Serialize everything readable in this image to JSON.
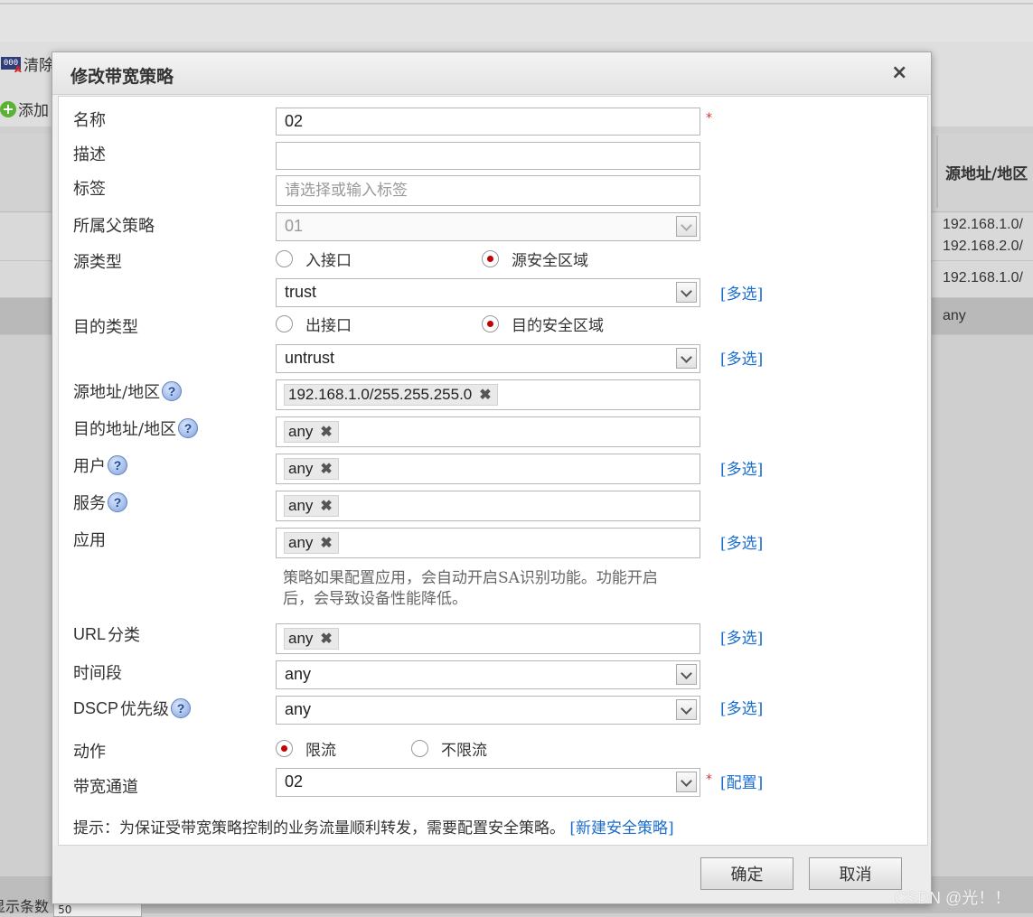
{
  "background": {
    "toolbar": {
      "clear_label": "清除",
      "add_label": "添加"
    },
    "table": {
      "column_header": "源地址/地区",
      "cells": [
        "192.168.1.0/",
        "192.168.2.0/",
        "192.168.1.0/",
        "any"
      ]
    },
    "pager_label": "显示条数",
    "pager_value": "50"
  },
  "dialog": {
    "title": "修改带宽策略",
    "close_symbol": "×",
    "fields": {
      "name": {
        "label": "名称",
        "value": "02",
        "required": "*"
      },
      "description": {
        "label": "描述",
        "value": ""
      },
      "tag": {
        "label": "标签",
        "placeholder": "请选择或输入标签"
      },
      "parent_policy": {
        "label": "所属父策略",
        "value": "01"
      },
      "source_type": {
        "label": "源类型",
        "options": [
          "入接口",
          "源安全区域"
        ],
        "selected": "源安全区域",
        "zone_value": "trust",
        "multi_link": "[多选]"
      },
      "dest_type": {
        "label": "目的类型",
        "options": [
          "出接口",
          "目的安全区域"
        ],
        "selected": "目的安全区域",
        "zone_value": "untrust",
        "multi_link": "[多选]"
      },
      "source_address": {
        "label": "源地址/地区",
        "tag": "192.168.1.0/255.255.255.0"
      },
      "dest_address": {
        "label": "目的地址/地区",
        "tag": "any"
      },
      "user": {
        "label": "用户",
        "tag": "any",
        "multi_link": "[多选]"
      },
      "service": {
        "label": "服务",
        "tag": "any"
      },
      "application": {
        "label": "应用",
        "tag": "any",
        "multi_link": "[多选]",
        "note_line1": "策略如果配置应用，会自动开启SA识别功能。功能开启",
        "note_line2": "后，会导致设备性能降低。"
      },
      "url_category": {
        "label_latin": "URL",
        "label_cn": "分类",
        "tag": "any",
        "multi_link": "[多选]"
      },
      "time_range": {
        "label": "时间段",
        "value": "any"
      },
      "dscp": {
        "label_latin": "DSCP",
        "label_cn": "优先级",
        "value": "any",
        "multi_link": "[多选]"
      },
      "action": {
        "label": "动作",
        "options": [
          "限流",
          "不限流"
        ],
        "selected": "限流"
      },
      "bandwidth_channel": {
        "label": "带宽通道",
        "value": "02",
        "required": "*",
        "config_link": "[配置]"
      }
    },
    "tip": {
      "text": "提示：为保证受带宽策略控制的业务流量顺利转发，需要配置安全策略。",
      "link": "[新建安全策略]"
    },
    "buttons": {
      "ok": "确定",
      "cancel": "取消"
    },
    "help_symbol": "?",
    "remove_symbol": "✖"
  },
  "watermark": "CSDN @光！！"
}
